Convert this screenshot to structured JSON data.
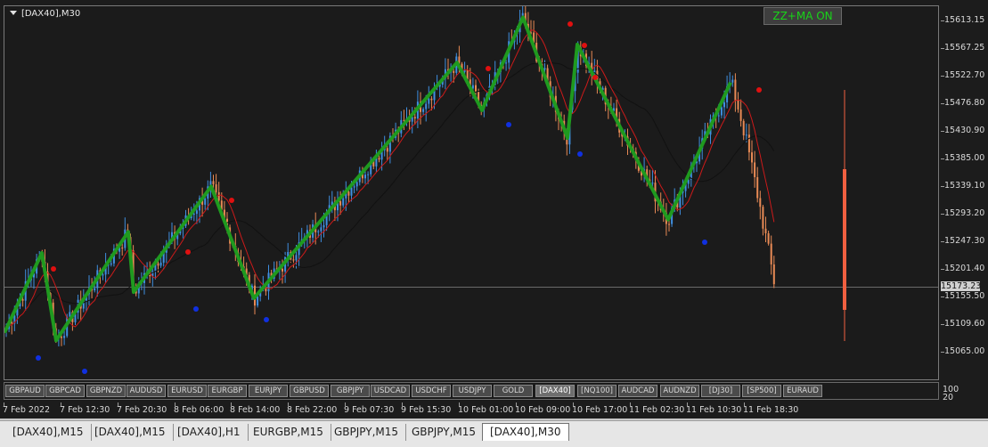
{
  "chart": {
    "title": "[DAX40],M30",
    "button_label": "ZZ+MA ON",
    "current_price": "15173.23",
    "price_labels": [
      "15613.15",
      "15567.25",
      "15522.70",
      "15476.80",
      "15430.90",
      "15385.00",
      "15339.10",
      "15293.20",
      "15247.30",
      "15201.40",
      "15155.50",
      "15109.60",
      "15065.00"
    ],
    "time_labels": [
      "7 Feb 2022",
      "7 Feb 12:30",
      "7 Feb 20:30",
      "8 Feb 06:00",
      "8 Feb 14:00",
      "8 Feb 22:00",
      "9 Feb 07:30",
      "9 Feb 15:30",
      "10 Feb 01:00",
      "10 Feb 09:00",
      "10 Feb 17:00",
      "11 Feb 02:30",
      "11 Feb 10:30",
      "11 Feb 18:30"
    ],
    "indicator_levels": [
      "100",
      "20"
    ],
    "colors": {
      "background": "#1b1b1b",
      "bull_candle": "#3f8fe0",
      "bear_candle": "#e88a55",
      "zigzag": "#1f9a1f",
      "ma_fast": "#cc1a1a",
      "ma_slow": "#111111",
      "dot_high": "#e01010",
      "dot_low": "#1030e0",
      "current_bar": "#f06040"
    }
  },
  "symbols": {
    "items": [
      "GBPAUD",
      "GBPCAD",
      "GBPNZD",
      "AUDUSD",
      "EURUSD",
      "EURGBP",
      "EURJPY",
      "GBPUSD",
      "GBPJPY",
      "USDCAD",
      "USDCHF",
      "USDJPY",
      "GOLD",
      "[DAX40]",
      "[NQ100]",
      "AUDCAD",
      "AUDNZD",
      "[DJ30]",
      "[SP500]",
      "EURAUD"
    ],
    "active": "[DAX40]"
  },
  "tabs": {
    "items": [
      "[DAX40],M15",
      "[DAX40],M15",
      "[DAX40],H1",
      "EURGBP,M15",
      "GBPJPY,M15",
      "GBPJPY,M15",
      "[DAX40],M30"
    ],
    "active_index": 6
  },
  "chart_data": {
    "type": "candlestick",
    "instrument": "[DAX40]",
    "timeframe": "M30",
    "zigzag_points": [
      {
        "time": "7 Feb 2022",
        "price": 15098
      },
      {
        "time": "7 Feb 06:00",
        "price": 15230
      },
      {
        "time": "7 Feb 09:30",
        "price": 15085
      },
      {
        "time": "7 Feb 20:00",
        "price": 15265
      },
      {
        "time": "7 Feb 22:00",
        "price": 15165
      },
      {
        "time": "8 Feb 11:30",
        "price": 15340
      },
      {
        "time": "8 Feb 16:00",
        "price": 15155
      },
      {
        "time": "10 Feb 00:00",
        "price": 15545
      },
      {
        "time": "10 Feb 03:00",
        "price": 15466
      },
      {
        "time": "10 Feb 08:00",
        "price": 15620
      },
      {
        "time": "10 Feb 13:00",
        "price": 15420
      },
      {
        "time": "10 Feb 14:30",
        "price": 15575
      },
      {
        "time": "11 Feb 03:30",
        "price": 15285
      },
      {
        "time": "11 Feb 09:00",
        "price": 15512
      }
    ],
    "last_price": 15173.23,
    "ylim": [
      15065.0,
      15613.15
    ]
  }
}
